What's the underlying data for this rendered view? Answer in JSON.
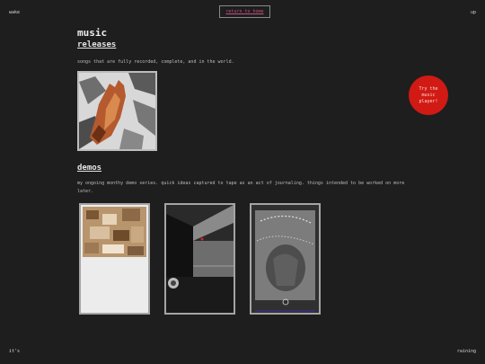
{
  "corners": {
    "top_left": "wake",
    "top_right": "up",
    "bottom_left": "it's",
    "bottom_right": "raining"
  },
  "nav": {
    "return_label": "return to home"
  },
  "page": {
    "title": "music"
  },
  "releases": {
    "heading": "releases",
    "description": "songs that are fully recorded, complete, and in the world."
  },
  "demos": {
    "heading": "demos",
    "description": "my ongoing monthy demo series. quick ideas captured to tape as an act of journaling. things intended to be worked on more later."
  },
  "badge": {
    "label": "Try the music player!"
  },
  "colors": {
    "background": "#1e1e1e",
    "badge": "#d11a14",
    "link": "#c24f7e"
  }
}
